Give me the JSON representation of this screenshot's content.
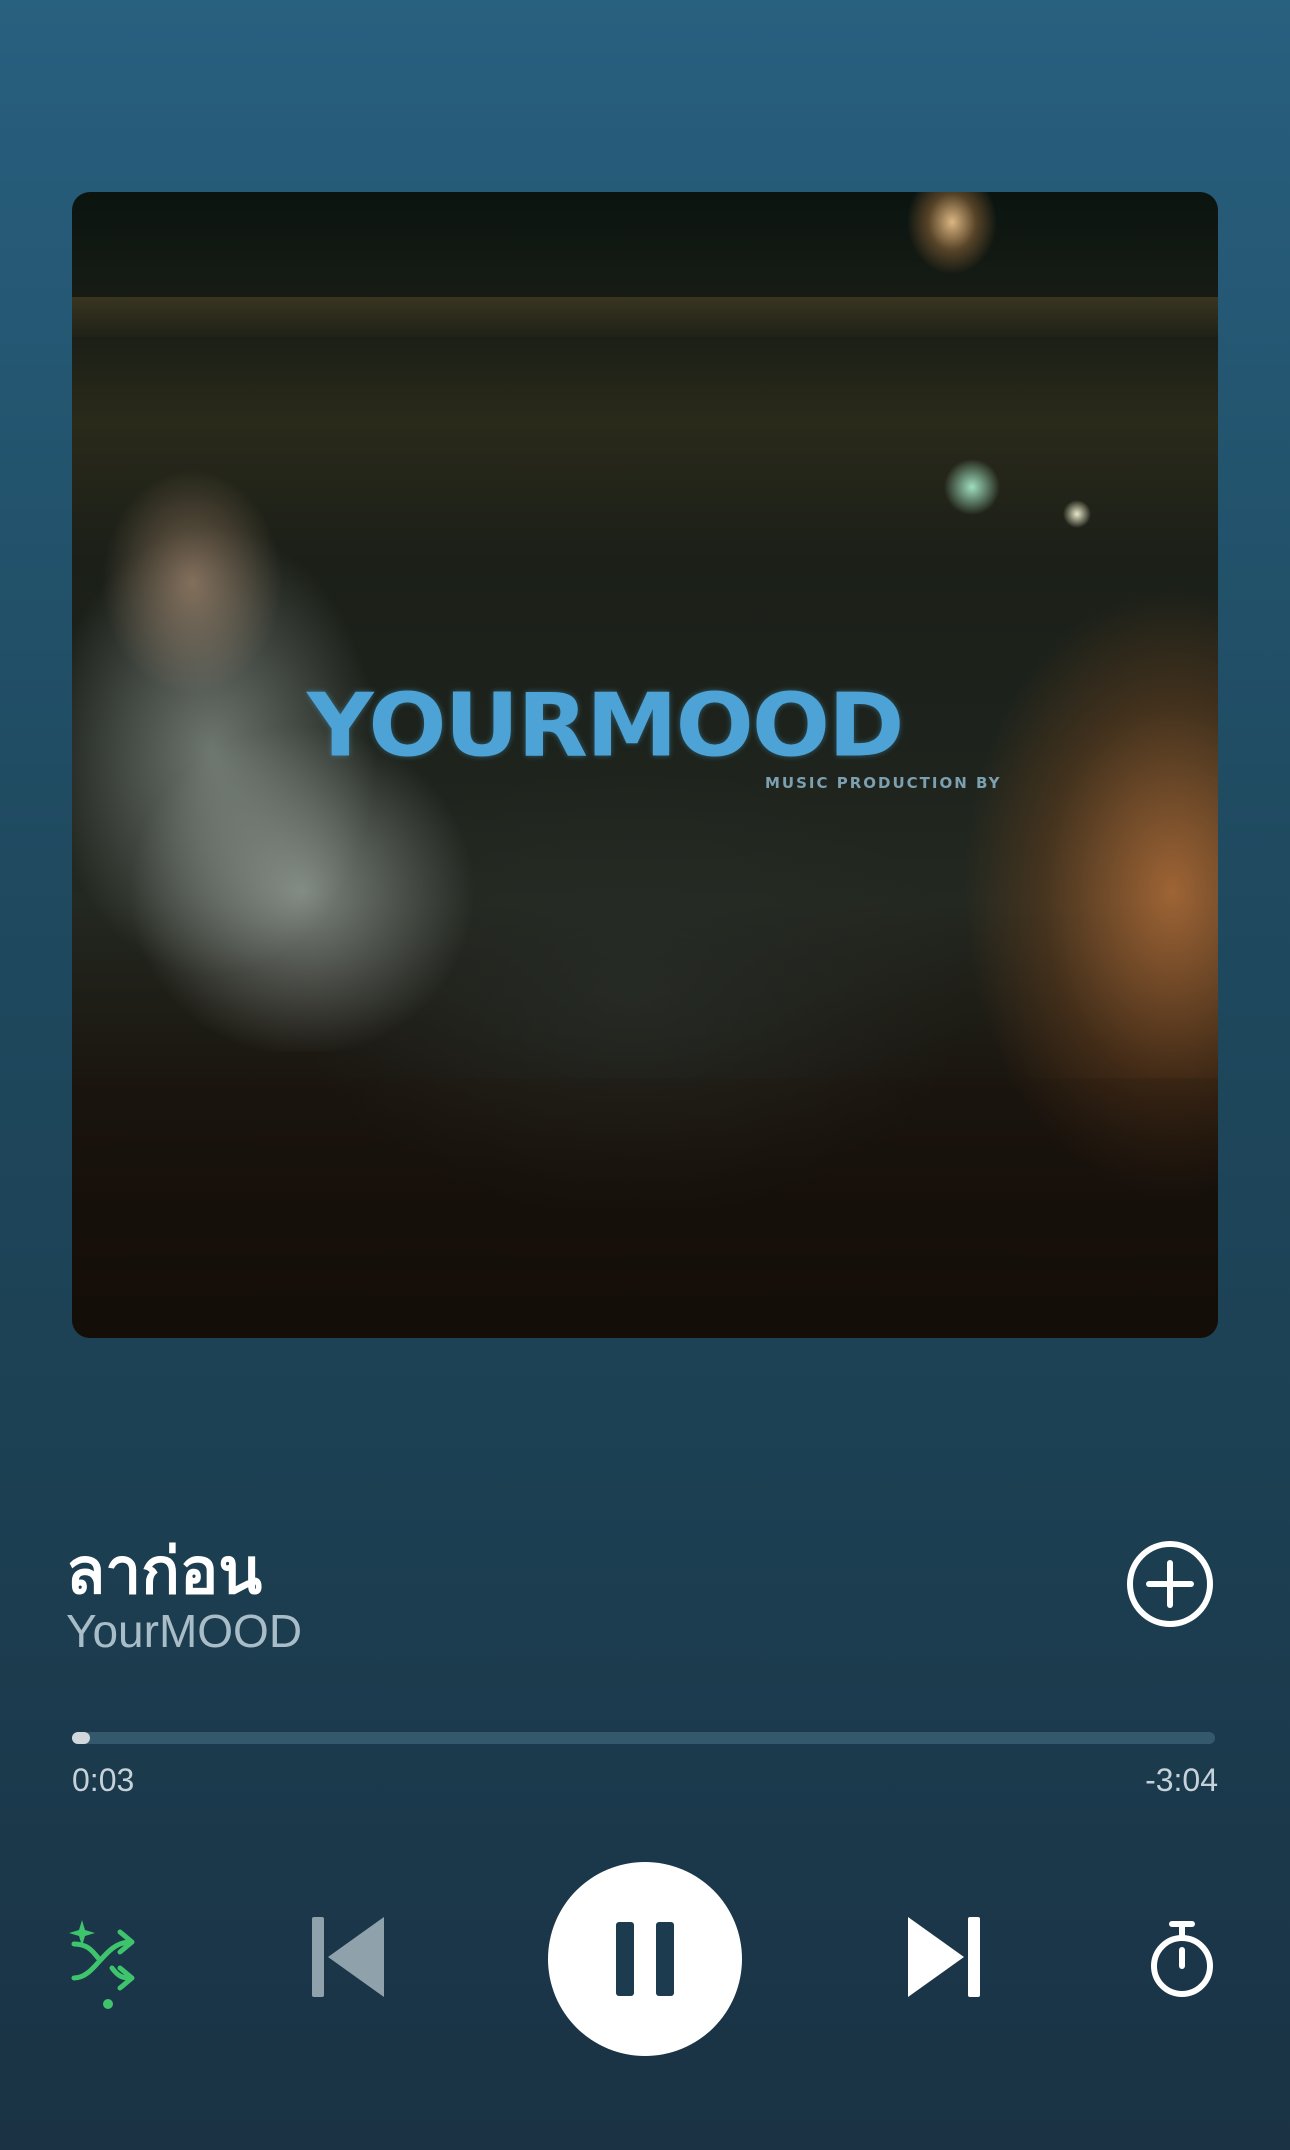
{
  "track": {
    "title": "ลาก่อน",
    "artist": "YourMOOD"
  },
  "artwork": {
    "logo_text": "YOURMOOD",
    "logo_subtext": "MUSIC PRODUCTION BY"
  },
  "playback": {
    "elapsed": "0:03",
    "remaining": "-3:04",
    "progress_fraction": 0.016,
    "state": "playing"
  },
  "controls": {
    "shuffle_icon": "smart-shuffle-icon",
    "previous_icon": "skip-back-icon",
    "pause_icon": "pause-icon",
    "next_icon": "skip-forward-icon",
    "timer_icon": "sleep-timer-icon",
    "add_icon": "add-circle-icon"
  },
  "colors": {
    "accent_green": "#3ec46d",
    "progress_fill": "#d0d8dc",
    "progress_track": "#35596c"
  }
}
